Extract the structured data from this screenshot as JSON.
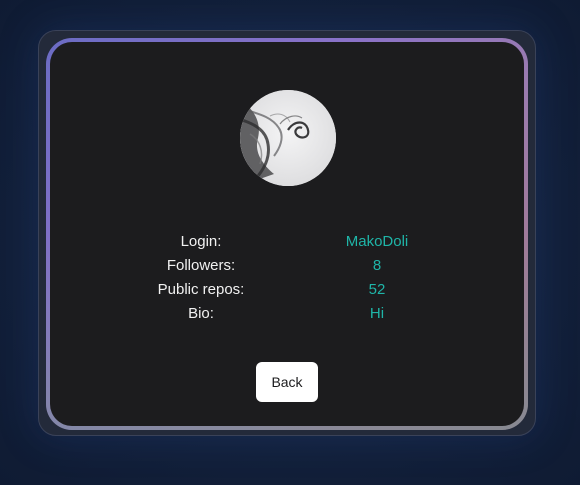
{
  "profile": {
    "avatar_icon": "user-avatar-photo",
    "rows": [
      {
        "label": "Login:",
        "value": "MakoDoli"
      },
      {
        "label": "Followers:",
        "value": "8"
      },
      {
        "label": "Public repos:",
        "value": "52"
      },
      {
        "label": "Bio:",
        "value": "Hi"
      }
    ]
  },
  "actions": {
    "back_label": "Back"
  },
  "colors": {
    "background": "#14223d",
    "card": "#1c1c1e",
    "value_accent": "#1fb5a8",
    "border_gradient_start": "#6b6cc4",
    "border_gradient_end": "#9a7a8c"
  }
}
